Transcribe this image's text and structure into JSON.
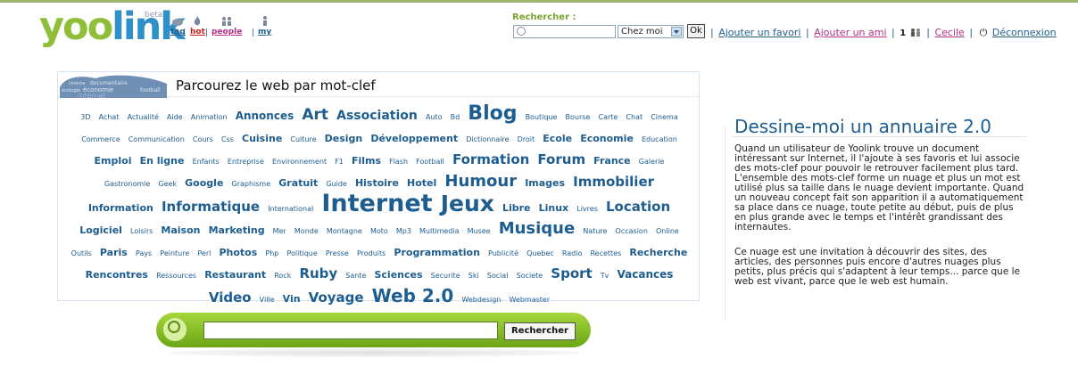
{
  "brand": {
    "logo_y": "yoo",
    "logo_l": "link",
    "beta": "beta"
  },
  "nav": {
    "tag": "tag",
    "hot": "hot",
    "people": "people",
    "my": "my",
    "sep1": "|",
    "sep2": "|",
    "sep3": "|"
  },
  "top_search": {
    "label": "Rechercher :",
    "scope_selected": "Chez moi",
    "ok_label": "Ok"
  },
  "account_links": {
    "add_favorite": "Ajouter un favori",
    "add_friend": "Ajouter un ami",
    "count": "1",
    "user": "Cecile",
    "logout": "Déconnexion",
    "sep": "|"
  },
  "cloud": {
    "badge_words": [
      "cinéma",
      "documentaire",
      "économie",
      "écologie",
      "football",
      "internet"
    ],
    "title": "Parcourez le web par mot-clef",
    "tags": [
      {
        "t": "3D",
        "s": 8
      },
      {
        "t": "Achat",
        "s": 8
      },
      {
        "t": "Actualité",
        "s": 8
      },
      {
        "t": "Aide",
        "s": 8
      },
      {
        "t": "Animation",
        "s": 8
      },
      {
        "t": "Annonces",
        "s": 12
      },
      {
        "t": "Art",
        "s": 17
      },
      {
        "t": "Association",
        "s": 14
      },
      {
        "t": "Auto",
        "s": 8
      },
      {
        "t": "Bd",
        "s": 8
      },
      {
        "t": "Blog",
        "s": 22
      },
      {
        "t": "Boutique",
        "s": 8
      },
      {
        "t": "Bourse",
        "s": 8
      },
      {
        "t": "Carte",
        "s": 8
      },
      {
        "t": "Chat",
        "s": 8
      },
      {
        "t": "Cinema",
        "s": 8
      },
      {
        "t": "Commerce",
        "s": 8
      },
      {
        "t": "Communication",
        "s": 8
      },
      {
        "t": "Cours",
        "s": 8
      },
      {
        "t": "Css",
        "s": 8
      },
      {
        "t": "Cuisine",
        "s": 11
      },
      {
        "t": "Culture",
        "s": 8
      },
      {
        "t": "Design",
        "s": 11
      },
      {
        "t": "Développement",
        "s": 11
      },
      {
        "t": "Dictionnaire",
        "s": 8
      },
      {
        "t": "Droit",
        "s": 8
      },
      {
        "t": "Ecole",
        "s": 11
      },
      {
        "t": "Economie",
        "s": 11
      },
      {
        "t": "Education",
        "s": 8
      },
      {
        "t": "Emploi",
        "s": 11
      },
      {
        "t": "En ligne",
        "s": 11
      },
      {
        "t": "Enfants",
        "s": 8
      },
      {
        "t": "Entreprise",
        "s": 8
      },
      {
        "t": "Environnement",
        "s": 8
      },
      {
        "t": "F1",
        "s": 8
      },
      {
        "t": "Films",
        "s": 11
      },
      {
        "t": "Flash",
        "s": 8
      },
      {
        "t": "Football",
        "s": 8
      },
      {
        "t": "Formation",
        "s": 15
      },
      {
        "t": "Forum",
        "s": 15
      },
      {
        "t": "France",
        "s": 11
      },
      {
        "t": "Galerie",
        "s": 8
      },
      {
        "t": "Gastronomie",
        "s": 8
      },
      {
        "t": "Geek",
        "s": 8
      },
      {
        "t": "Google",
        "s": 11
      },
      {
        "t": "Graphisme",
        "s": 8
      },
      {
        "t": "Gratuit",
        "s": 11
      },
      {
        "t": "Guide",
        "s": 8
      },
      {
        "t": "Histoire",
        "s": 11
      },
      {
        "t": "Hotel",
        "s": 11
      },
      {
        "t": "Humour",
        "s": 18
      },
      {
        "t": "Images",
        "s": 11
      },
      {
        "t": "Immobilier",
        "s": 15
      },
      {
        "t": "Information",
        "s": 11
      },
      {
        "t": "Informatique",
        "s": 15
      },
      {
        "t": "International",
        "s": 8
      },
      {
        "t": "Internet",
        "s": 27
      },
      {
        "t": "Jeux",
        "s": 25
      },
      {
        "t": "Libre",
        "s": 11
      },
      {
        "t": "Linux",
        "s": 11
      },
      {
        "t": "Livres",
        "s": 8
      },
      {
        "t": "Location",
        "s": 15
      },
      {
        "t": "Logiciel",
        "s": 11
      },
      {
        "t": "Loisirs",
        "s": 8
      },
      {
        "t": "Maison",
        "s": 11
      },
      {
        "t": "Marketing",
        "s": 11
      },
      {
        "t": "Mer",
        "s": 8
      },
      {
        "t": "Monde",
        "s": 8
      },
      {
        "t": "Montagne",
        "s": 8
      },
      {
        "t": "Moto",
        "s": 8
      },
      {
        "t": "Mp3",
        "s": 8
      },
      {
        "t": "Multimedia",
        "s": 8
      },
      {
        "t": "Musee",
        "s": 8
      },
      {
        "t": "Musique",
        "s": 18
      },
      {
        "t": "Nature",
        "s": 8
      },
      {
        "t": "Occasion",
        "s": 8
      },
      {
        "t": "Online",
        "s": 8
      },
      {
        "t": "Outils",
        "s": 8
      },
      {
        "t": "Paris",
        "s": 11
      },
      {
        "t": "Pays",
        "s": 8
      },
      {
        "t": "Peinture",
        "s": 8
      },
      {
        "t": "Perl",
        "s": 8
      },
      {
        "t": "Photos",
        "s": 11
      },
      {
        "t": "Php",
        "s": 8
      },
      {
        "t": "Politique",
        "s": 8
      },
      {
        "t": "Presse",
        "s": 8
      },
      {
        "t": "Produits",
        "s": 8
      },
      {
        "t": "Programmation",
        "s": 11
      },
      {
        "t": "Publicité",
        "s": 8
      },
      {
        "t": "Quebec",
        "s": 8
      },
      {
        "t": "Radio",
        "s": 8
      },
      {
        "t": "Recettes",
        "s": 8
      },
      {
        "t": "Recherche",
        "s": 11
      },
      {
        "t": "Rencontres",
        "s": 11
      },
      {
        "t": "Ressources",
        "s": 8
      },
      {
        "t": "Restaurant",
        "s": 11
      },
      {
        "t": "Rock",
        "s": 8
      },
      {
        "t": "Ruby",
        "s": 15
      },
      {
        "t": "Sante",
        "s": 8
      },
      {
        "t": "Sciences",
        "s": 11
      },
      {
        "t": "Securite",
        "s": 8
      },
      {
        "t": "Ski",
        "s": 8
      },
      {
        "t": "Social",
        "s": 8
      },
      {
        "t": "Societe",
        "s": 8
      },
      {
        "t": "Sport",
        "s": 15
      },
      {
        "t": "Tv",
        "s": 8
      },
      {
        "t": "Vacances",
        "s": 12
      },
      {
        "t": "Video",
        "s": 15
      },
      {
        "t": "Ville",
        "s": 8
      },
      {
        "t": "Vin",
        "s": 11
      },
      {
        "t": "Voyage",
        "s": 15
      },
      {
        "t": "Web 2.0",
        "s": 20
      },
      {
        "t": "Webdesign",
        "s": 8
      },
      {
        "t": "Webmaster",
        "s": 8
      }
    ]
  },
  "annuaire": {
    "title": "Dessine-moi un annuaire 2.0",
    "para1": "Quand un utilisateur de Yoolink trouve un document intéressant sur Internet, il l'ajoute à ses favoris et lui associe des mots-clef pour pouvoir le retrouver facilement plus tard. L'ensemble des mots-clef forme un nuage et plus un mot est utilisé plus sa taille dans le nuage devient importante. Quand un nouveau concept fait son apparition il a automatiquement sa place dans ce nuage, toute petite au début, puis de plus en plus grande avec le temps et l'intérêt grandissant des internautes.",
    "para2": "Ce nuage est une invitation à découvrir des sites, des articles, des personnes puis encore d'autres nuages plus petits, plus précis qui s'adaptent à leur temps... parce que le web est vivant, parce que le web est humain."
  },
  "bottom_search": {
    "button_label": "Rechercher"
  },
  "colors": {
    "accent_green": "#8fbf3a",
    "link_blue": "#1f5f8f",
    "hot_red": "#cc2222",
    "people_pink": "#b0308a"
  }
}
